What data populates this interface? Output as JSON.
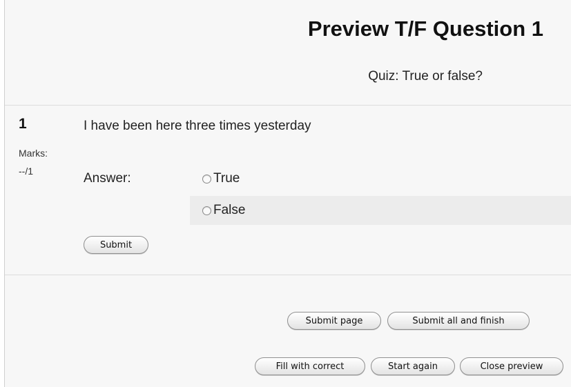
{
  "page": {
    "title": "Preview T/F Question 1",
    "subtitle": "Quiz: True or false?"
  },
  "question": {
    "number": "1",
    "marks_label": "Marks:",
    "marks_value": "--/1",
    "text": "I have been here three times yesterday",
    "answer_label": "Answer:",
    "options": [
      {
        "label": "True",
        "selected": false
      },
      {
        "label": "False",
        "selected": false
      }
    ],
    "submit_label": "Submit"
  },
  "footer": {
    "submit_page_label": "Submit page",
    "submit_all_label": "Submit all and finish",
    "fill_correct_label": "Fill with correct",
    "start_again_label": "Start again",
    "close_preview_label": "Close preview"
  }
}
